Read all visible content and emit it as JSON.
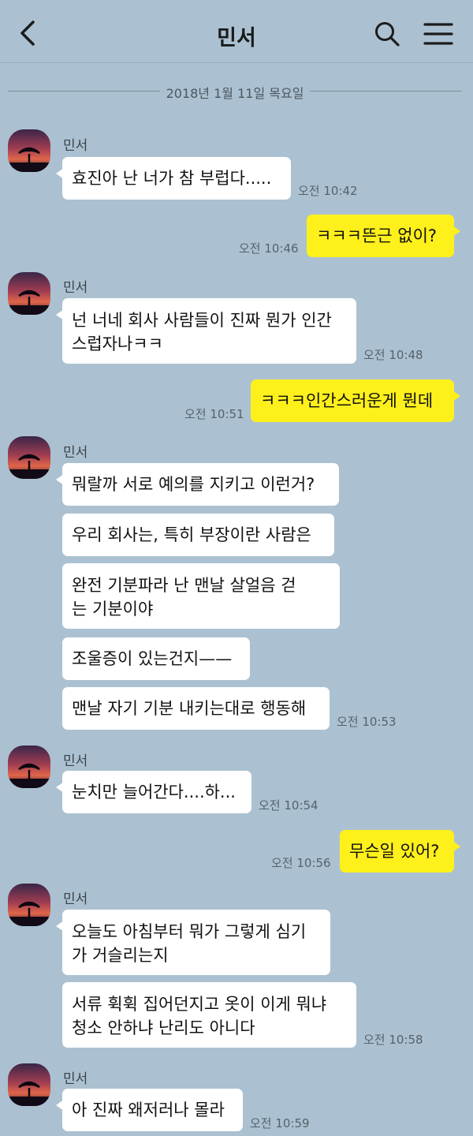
{
  "header": {
    "title": "민서",
    "back_icon": "chevron-left-icon",
    "search_icon": "search-icon",
    "menu_icon": "hamburger-menu-icon"
  },
  "date_separator": "2018년 1월 11일 목요일",
  "colors": {
    "background": "#abc1d1",
    "my_bubble": "#fef01b",
    "their_bubble": "#ffffff"
  },
  "messages": [
    {
      "sender": "민서",
      "text": "효진아 난 너가 참 부럽다.....",
      "time": "오전 10:42"
    },
    {
      "sender": "me",
      "text": "ㅋㅋㅋ뜬근 없이?",
      "time": "오전 10:46"
    },
    {
      "sender": "민서",
      "lines": [
        "넌 너네 회사 사람들이 진짜 뭔가 인간",
        "스럽자나ㅋㅋ"
      ],
      "time": "오전 10:48"
    },
    {
      "sender": "me",
      "text": "ㅋㅋㅋ인간스러운게 뭔데",
      "time": "오전 10:51"
    },
    {
      "sender": "민서",
      "text": "뭐랄까 서로 예의를 지키고 이런거?"
    },
    {
      "sender": "민서",
      "text": "우리 회사는, 특히 부장이란 사람은"
    },
    {
      "sender": "민서",
      "lines": [
        "완전 기분파라 난 맨날 살얼음 걷",
        "는 기분이야"
      ]
    },
    {
      "sender": "민서",
      "text": "조울증이 있는건지——"
    },
    {
      "sender": "민서",
      "text": "맨날 자기 기분 내키는대로 행동해",
      "time": "오전 10:53"
    },
    {
      "sender": "민서",
      "text": "눈치만 늘어간다....하...",
      "time": "오전 10:54"
    },
    {
      "sender": "me",
      "text": "무슨일 있어?",
      "time": "오전 10:56"
    },
    {
      "sender": "민서",
      "lines": [
        "오늘도 아침부터 뭐가 그렇게 심기",
        "가 거슬리는지"
      ]
    },
    {
      "sender": "민서",
      "lines": [
        "서류 휙휙 집어던지고 옷이 이게 뭐냐",
        "청소 안하냐 난리도 아니다"
      ],
      "time": "오전 10:58"
    },
    {
      "sender": "민서",
      "text": "아 진짜 왜저러나 몰라",
      "time": "오전 10:59"
    }
  ]
}
